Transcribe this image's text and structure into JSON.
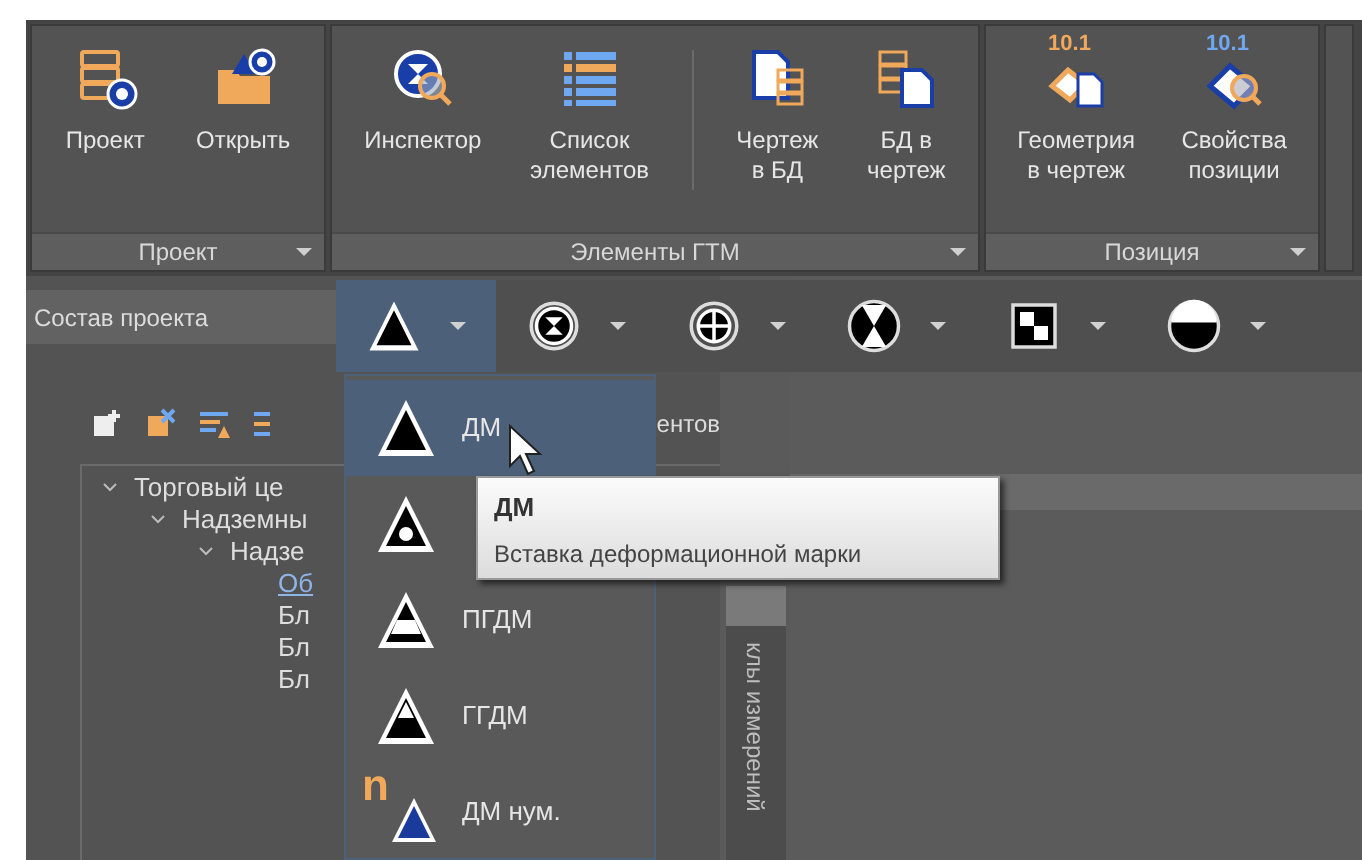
{
  "ribbon": {
    "groups": [
      {
        "label": "Проект",
        "dropdown": true,
        "buttons": [
          {
            "label": "Проект",
            "kind": "project"
          },
          {
            "label": "Открыть",
            "kind": "open"
          }
        ]
      },
      {
        "label": "Элементы ГТМ",
        "dropdown": true,
        "buttons": [
          {
            "label": "Инспектор",
            "kind": "inspector"
          },
          {
            "label": "Список\nэлементов",
            "kind": "list"
          },
          {
            "label": "Чертеж\nв БД",
            "kind": "drawing-to-db",
            "separator_before": true
          },
          {
            "label": "БД в\nчертеж",
            "kind": "db-to-drawing"
          }
        ]
      },
      {
        "label": "Позиция",
        "dropdown": true,
        "buttons": [
          {
            "label": "Геометрия\nв чертеж",
            "kind": "geometry",
            "badge": "10.1"
          },
          {
            "label": "Свойства\nпозиции",
            "kind": "properties",
            "badge": "10.1"
          }
        ]
      }
    ]
  },
  "panel": {
    "title": "Состав проекта",
    "caption": "ентов",
    "tree": [
      {
        "label": "Торговый це",
        "expanded": true,
        "children": [
          {
            "label": "Надземны",
            "expanded": true,
            "children": [
              {
                "label": "Надзе",
                "expanded": true,
                "children": [
                  {
                    "label": "Об",
                    "selected": true
                  },
                  {
                    "label": "Бл",
                    "selected": false
                  },
                  {
                    "label": "Бл",
                    "selected": false
                  },
                  {
                    "label": "Бл",
                    "selected": false
                  }
                ]
              }
            ]
          }
        ]
      }
    ]
  },
  "side_tab": {
    "label": "клы измерений"
  },
  "mark_toolbar": [
    {
      "kind": "triangle",
      "selected": true
    },
    {
      "kind": "ring-hourglass",
      "selected": false
    },
    {
      "kind": "ring-cross",
      "selected": false
    },
    {
      "kind": "disc-hourglass",
      "selected": false
    },
    {
      "kind": "checker",
      "selected": false
    },
    {
      "kind": "half",
      "selected": false
    }
  ],
  "mark_menu": [
    {
      "label": "ДМ",
      "kind": "triangle",
      "selected": true
    },
    {
      "kind": "triangle-dot",
      "selected": false
    },
    {
      "label": "ПГДМ",
      "kind": "triangle-band",
      "selected": false
    },
    {
      "label": "ГГДМ",
      "kind": "triangle-top",
      "selected": false
    },
    {
      "label": "ДМ нум.",
      "kind": "numbered",
      "prefix": "n",
      "selected": false
    }
  ],
  "tooltip": {
    "title": "ДМ",
    "text": "Вставка деформационной марки"
  }
}
